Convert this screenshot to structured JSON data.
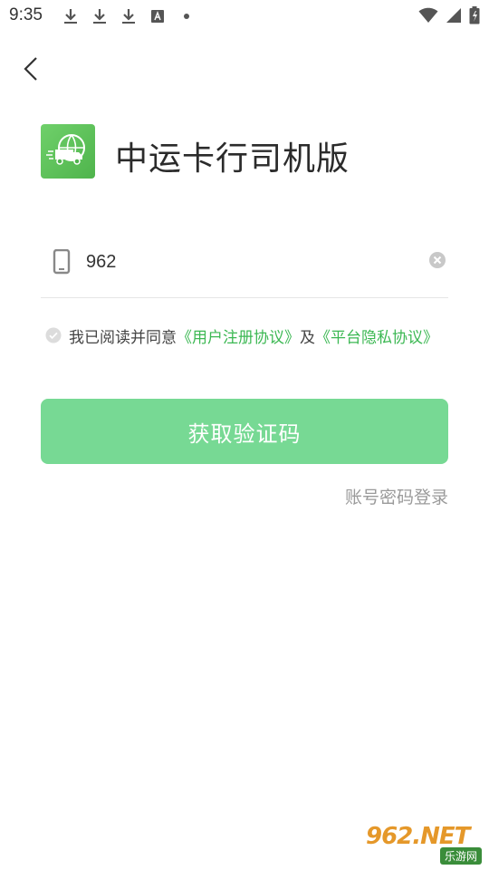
{
  "status_bar": {
    "time": "9:35",
    "left_icons": [
      "download-icon",
      "download-icon",
      "download-icon",
      "text-a-icon",
      "dot-icon"
    ],
    "right_icons": [
      "wifi-icon",
      "signal-icon",
      "battery-charging-icon"
    ]
  },
  "header": {
    "back_icon": "chevron-left-icon"
  },
  "app": {
    "title": "中运卡行司机版",
    "logo_icon": "truck-globe-icon",
    "brand_color": "#5cc158"
  },
  "login_form": {
    "phone_value": "962",
    "phone_icon": "mobile-phone-icon",
    "clear_icon": "clear-circle-icon",
    "agreement": {
      "prefix": "我已阅读并同意",
      "user_agreement": "《用户注册协议》",
      "conjunction": "及",
      "privacy_policy": "《平台隐私协议》",
      "link_color": "#3cb853"
    },
    "submit_label": "获取验证码",
    "submit_color": "#77d994",
    "alt_login_label": "账号密码登录"
  },
  "watermark": {
    "main": "962.NET",
    "sub": "乐游网"
  }
}
